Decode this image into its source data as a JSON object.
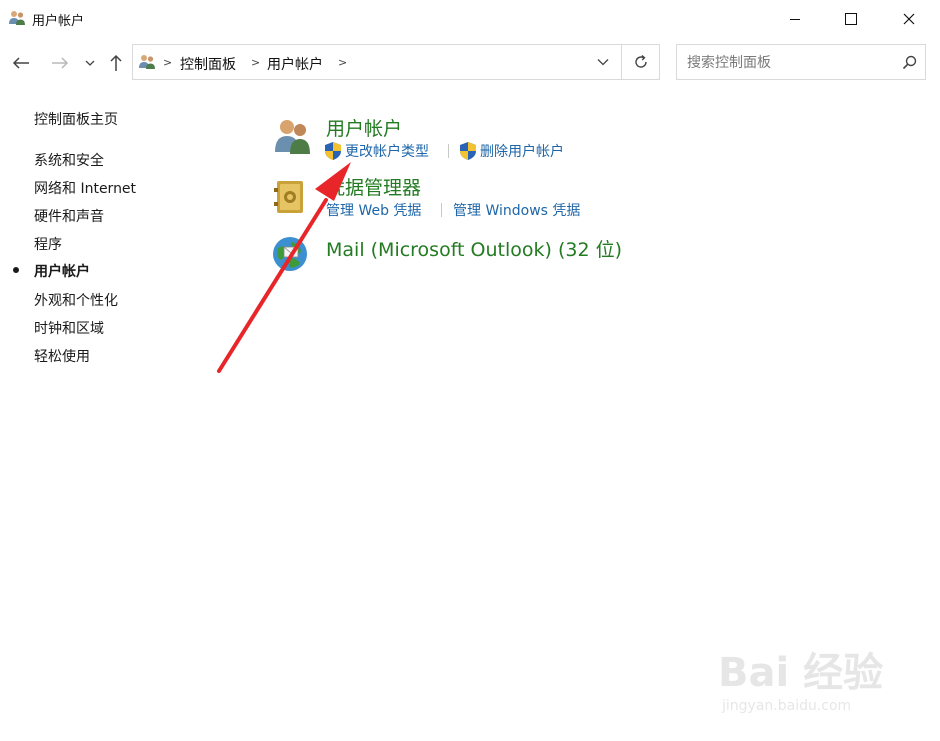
{
  "window": {
    "title": "用户帐户",
    "icon": "users-icon"
  },
  "nav": {
    "back_icon": "arrow-left-icon",
    "forward_icon": "arrow-right-icon",
    "recent_icon": "chevron-down-icon",
    "up_icon": "arrow-up-icon"
  },
  "address": {
    "crumbs": [
      "控制面板",
      "用户帐户"
    ],
    "dropdown_icon": "chevron-down-icon",
    "refresh_icon": "refresh-icon"
  },
  "search": {
    "placeholder": "搜索控制面板",
    "icon": "search-icon"
  },
  "sidebar": {
    "home": "控制面板主页",
    "items": [
      {
        "label": "系统和安全",
        "active": false
      },
      {
        "label": "网络和 Internet",
        "active": false
      },
      {
        "label": "硬件和声音",
        "active": false
      },
      {
        "label": "程序",
        "active": false
      },
      {
        "label": "用户帐户",
        "active": true
      },
      {
        "label": "外观和个性化",
        "active": false
      },
      {
        "label": "时钟和区域",
        "active": false
      },
      {
        "label": "轻松使用",
        "active": false
      }
    ]
  },
  "main": {
    "categories": [
      {
        "title": "用户帐户",
        "icon": "users-icon",
        "links": [
          {
            "label": "更改帐户类型",
            "shield": true
          },
          {
            "label": "删除用户帐户",
            "shield": true
          }
        ]
      },
      {
        "title": "凭据管理器",
        "icon": "vault-icon",
        "links": [
          {
            "label": "管理 Web 凭据",
            "shield": false
          },
          {
            "label": "管理 Windows 凭据",
            "shield": false
          }
        ]
      },
      {
        "title": "Mail (Microsoft Outlook) (32 位)",
        "icon": "mail-globe-icon",
        "links": []
      }
    ]
  },
  "watermark": {
    "brand": "Bai 经验",
    "url": "jingyan.baidu.com"
  },
  "colors": {
    "category_green": "#237b22",
    "link_blue": "#1e66a8",
    "annotation_red": "#e8262a"
  }
}
